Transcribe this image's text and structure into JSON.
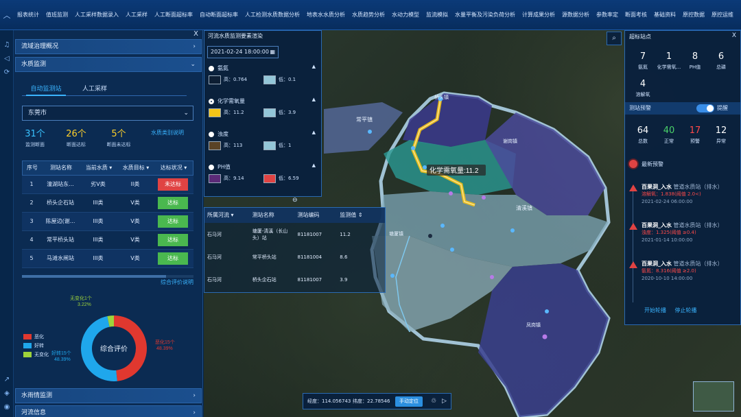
{
  "nav": {
    "items": [
      "报表统计",
      "值班监测",
      "人工采样数据录入",
      "人工采样",
      "人工断面超标率",
      "自动断面超标率",
      "人工检测水质数据分析",
      "地表水水质分析",
      "水质趋势分析",
      "水动力模型",
      "监流模拟",
      "水量平衡及污染负荷分析",
      "计算成果分析",
      "源数据分析",
      "参数率定",
      "断面考核",
      "基础资料",
      "原控数据",
      "原控运维"
    ]
  },
  "left_panel": {
    "close": "X",
    "section1": "流域治理概况",
    "section2": "水质监测",
    "tabs": [
      "自动监测站",
      "人工采样"
    ],
    "city_select": "东莞市",
    "stats": [
      {
        "value": "31个",
        "label": "监测断面",
        "color": "#39c3ff"
      },
      {
        "value": "26个",
        "label": "断面达标",
        "color": "#ffd02a"
      },
      {
        "value": "5个",
        "label": "断面未达标",
        "color": "#ffd02a"
      }
    ],
    "standard_link": "水质类别说明",
    "table": {
      "headers": [
        "序号",
        "测站名称",
        "当前水质",
        "水质目标",
        "达标状况"
      ],
      "rows": [
        {
          "idx": "1",
          "name": "潼湖站东...",
          "current": "劣V类",
          "target": "II类",
          "status": "未达标",
          "ok": false
        },
        {
          "idx": "2",
          "name": "桥头企石站",
          "current": "III类",
          "target": "V类",
          "status": "达标",
          "ok": true
        },
        {
          "idx": "3",
          "name": "陈屋边(谢...",
          "current": "III类",
          "target": "V类",
          "status": "达标",
          "ok": true
        },
        {
          "idx": "4",
          "name": "常平桥头站",
          "current": "III类",
          "target": "V类",
          "status": "达标",
          "ok": true
        },
        {
          "idx": "5",
          "name": "马滩水闸站",
          "current": "III类",
          "target": "V类",
          "status": "达标",
          "ok": true
        }
      ]
    },
    "eval_link": "综合评价说明",
    "donut": {
      "center": "综合评价",
      "slices": [
        {
          "name": "恶化",
          "label": "恶化15个",
          "pct": "48.39%",
          "value": 48.39,
          "color": "#e0382f"
        },
        {
          "name": "好转",
          "label": "好转15个",
          "pct": "48.39%",
          "value": 48.39,
          "color": "#1fa7ec"
        },
        {
          "name": "无变化",
          "label": "无变化1个",
          "pct": "3.22%",
          "value": 3.22,
          "color": "#9ed33b"
        }
      ]
    },
    "section3": "水雨情监测",
    "section4": "河流信息"
  },
  "chart_panel": {
    "title": "河流水质监测要素渲染",
    "date": "2021-02-24 18:00:00",
    "indicators": [
      {
        "name": "氨氮",
        "high": "高：0.764",
        "low": "低：0.1",
        "hc": "#0d1e33",
        "lc": "#93c6d8",
        "selected": false
      },
      {
        "name": "化学需氧量",
        "high": "高：11.2",
        "low": "低：3.9",
        "hc": "#f5c518",
        "lc": "#93c6d8",
        "selected": true
      },
      {
        "name": "浊度",
        "high": "高：113",
        "low": "低：1",
        "hc": "#5a4326",
        "lc": "#93c6d8",
        "selected": false
      },
      {
        "name": "PH值",
        "high": "高：9.14",
        "low": "低：6.59",
        "hc": "#5b2a78",
        "lc": "#e04343",
        "selected": false
      }
    ]
  },
  "data_table": {
    "headers": [
      "所属河流",
      "测站名称",
      "测站编码",
      "监测值"
    ],
    "rows": [
      {
        "river": "石马河",
        "name": "塘厦-清溪（长山头）站",
        "code": "81181007",
        "value": "11.2"
      },
      {
        "river": "石马河",
        "name": "常平桥头站",
        "code": "81181004",
        "value": "8.6"
      },
      {
        "river": "石马河",
        "name": "桥头企石站",
        "code": "81181007",
        "value": "3.9"
      }
    ]
  },
  "map": {
    "tooltip": "化学需氧量:11.2",
    "towns": [
      "桥头镇",
      "常平镇",
      "谢岗镇",
      "清溪镇",
      "塘厦镇",
      "凤岗镇"
    ]
  },
  "right_panel": {
    "title": "超标站点",
    "close": "X",
    "exceed": [
      {
        "value": "7",
        "label": "氨氮"
      },
      {
        "value": "1",
        "label": "化学需氧..."
      },
      {
        "value": "8",
        "label": "PH值"
      },
      {
        "value": "6",
        "label": "总磷"
      },
      {
        "value": "4",
        "label": "溶解氧"
      }
    ],
    "warn_label": "测站预警",
    "toggle_label": "提醒",
    "counts": [
      {
        "value": "64",
        "label": "总数",
        "color": "#ffffff"
      },
      {
        "value": "40",
        "label": "正常",
        "color": "#4ad36a"
      },
      {
        "value": "17",
        "label": "预警",
        "color": "#ff4a4a"
      },
      {
        "value": "12",
        "label": "异常",
        "color": "#ffffff"
      }
    ],
    "newest": "最新预警",
    "alarms": [
      {
        "station": "百果洞_入水",
        "type": "管道水质站（排水）",
        "detail": "溶解氧：1.838(阈值 2.0<)",
        "time": "2021-02-24 06:00:00"
      },
      {
        "station": "百果洞_入水",
        "type": "管道水质站（排水）",
        "detail": "浊度：1.325(阈值 ≥0.4)",
        "time": "2021-01-14 10:00:00"
      },
      {
        "station": "百果洞_入水",
        "type": "管道水质站（排水）",
        "detail": "氨氮：8.316(阈值 ≥2.0)",
        "time": "2020-10-10 14:00:00"
      }
    ],
    "btn_start": "开始轮播",
    "btn_stop": "停止轮播"
  },
  "coord": {
    "lon": "经度：114.056743",
    "lat": "纬度：22.78546",
    "locate": "手动定位"
  }
}
